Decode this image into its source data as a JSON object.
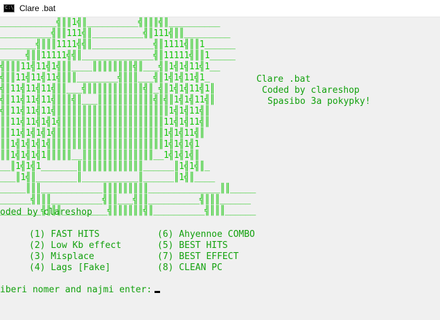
{
  "window": {
    "title": "Clare .bat",
    "icon": "cmd-icon"
  },
  "banner": {
    "art_lines": [
      "___________╣║║1╣║__________╣║║║╣║__________",
      "__________╣║║111╣║__________╣║111╣║║_________",
      "_______╣║║║1111╣╣║____________╣║1111╣║║1______",
      "_____╣║║11111╣╣║______________╣║11111╣║║1_____",
      "╣║║║11╣11╣1╣║║____║║║║║║║║╣║___╣║1╣1╣11╣1__",
      "╣║║11╣11╣11╣║║║________╣║║║___╣║1╣1╣11╣1_",
      "╣║11╣11╣11╣║║___╣║║║║║║║║║║║╣║_╣║1╣1╣11╣1║",
      "╣║11╣11╣11╣║║║╣║___║║║║║║║║║║║╣║╣║1╣1╣11╣║",
      "╣║11╣11╣11╣║║║║║║║║║║║║║║║║║║║║║║1╣1╣11╣║",
      "║║11╣11╣1╣1╣║║║║║║║║║║║║║║║║║║║║11╣1╣11╣║",
      "║║11╣1╣1╣1╣║║║║║║║║║║║║║║║║║║║║║1╣1╣11╣║",
      "║║1╣1╣1╣1╣║║║║║║║║║║║║║║║║║║║║║║1╣1╣1╣1",
      "║║1╣1╣1╣1║║║║║__║║║║║║║║║║║║║║__1╣1╣1╣║",
      "__║1╣1╣1_______║║║║║║║║║║║║║______║1╣1╣║_",
      "___║1╣║________║___________║______║1╣║____",
      "_____║║║____________║║║║║║║║║______________║║_____",
      "______╣║║║__________╣║║___╣║║__________╣║║║______",
      "________╣║║║_________╣║║║║║║╣║__________╣║║║______"
    ],
    "side_title": "Clare .bat",
    "side_credit": "Coded by clareshop",
    "side_thanks": "Spasibo 3a pokypky!"
  },
  "credit_line": "oded by clareshop",
  "menu": {
    "left": [
      "(1) FAST HITS",
      "(2) Low Kb effect",
      "(3) Misplace",
      "(4) Lags [Fake]"
    ],
    "right": [
      "(6) Ahyennoe COMBO",
      "(5) BEST HITS",
      "(7) BEST EFFECT",
      "(8) CLEAN PC"
    ]
  },
  "prompt": {
    "text": "iberi nomer and najmi enter:",
    "value": ""
  },
  "colors": {
    "text": "#13a10e",
    "art": "#16c60c",
    "background": "#f0f0f0",
    "cursor": "#000000"
  }
}
